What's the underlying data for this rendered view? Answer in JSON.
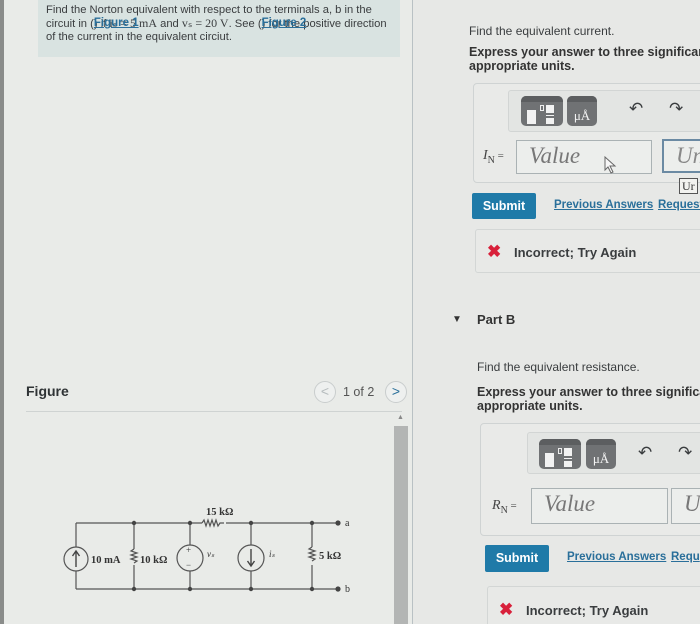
{
  "problem": {
    "text_1": "Find the Norton equivalent with respect to the terminals a, b in the circuit in (",
    "figure1_link": "Figure 1",
    "text_2": ") if ",
    "math_is": "iₛ = 5 mA",
    "text_3": " and ",
    "math_vs": "vₛ = 20 V",
    "text_4": ". See (",
    "figure2_link": "Figure 2",
    "text_5": ") for the positive direction of the current in the equivalent circiut."
  },
  "figure": {
    "title": "Figure",
    "page_indicator": "1 of 2",
    "prev_label": "<",
    "next_label": ">",
    "circuit": {
      "current_source_1": "10 mA",
      "resistor_1": "10 kΩ",
      "series_resistor": "15 kΩ",
      "voltage_source": "vₛ",
      "voltage_plus": "+",
      "voltage_minus": "−",
      "current_source_2": "iₛ",
      "resistor_load": "5 kΩ",
      "terminal_a": "a",
      "terminal_b": "b"
    }
  },
  "part_a": {
    "prompt": "Find the equivalent current.",
    "instruction_1": "Express your answer to three significant",
    "instruction_2": "appropriate units.",
    "label_var": "I",
    "label_sub": "N",
    "label_eq": " =",
    "value_placeholder": "Value",
    "units_placeholder": "Uni",
    "tooltip_stub": "Ur",
    "toolbar": {
      "templates_icon": "templates-icon",
      "units_icon": "units-icon",
      "units_glyph": "μÅ",
      "undo_glyph": "↶",
      "redo_glyph": "↷",
      "reset_glyph": "↻"
    },
    "submit_label": "Submit",
    "previous_answers_label": "Previous Answers",
    "request_answer_label": "Request",
    "feedback": "Incorrect; Try Again",
    "feedback_icon": "✖"
  },
  "part_b": {
    "title": "Part B",
    "caret": "▼",
    "prompt": "Find the equivalent resistance.",
    "instruction_1": "Express your answer to three significa",
    "instruction_2": "appropriate units.",
    "label_var": "R",
    "label_sub": "N",
    "label_eq": " =",
    "value_placeholder": "Value",
    "units_placeholder": "U",
    "toolbar": {
      "units_glyph": "μÅ",
      "undo_glyph": "↶",
      "redo_glyph": "↷"
    },
    "submit_label": "Submit",
    "previous_answers_label": "Previous Answers",
    "request_answer_label": "Requ",
    "feedback": "Incorrect; Try Again",
    "feedback_icon": "✖"
  },
  "colors": {
    "submit_bg": "#1f7aa8",
    "link": "#2a6f9a",
    "error": "#d8203a",
    "problem_bg": "#d9e3e1"
  }
}
